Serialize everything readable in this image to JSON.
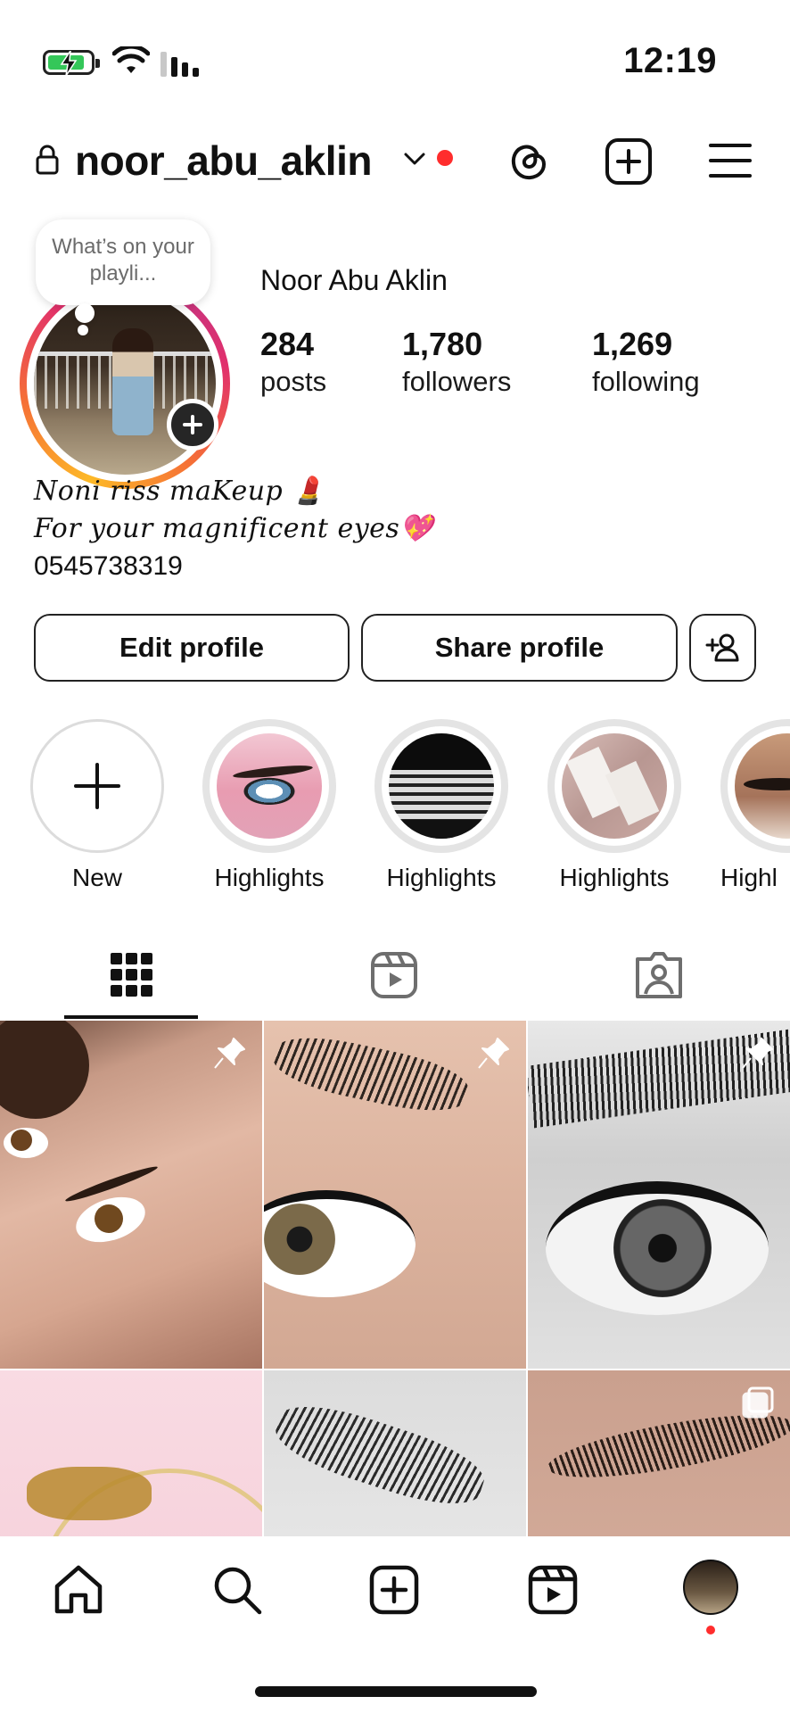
{
  "status_bar": {
    "time": "12:19"
  },
  "header": {
    "username": "noor_abu_aklin"
  },
  "profile": {
    "note": "What’s on your playli...",
    "display_name": "Noor Abu Aklin",
    "stats": [
      {
        "value": "284",
        "label": "posts"
      },
      {
        "value": "1,780",
        "label": "followers"
      },
      {
        "value": "1,269",
        "label": "following"
      }
    ],
    "bio": {
      "line1": "Noni riss maKeup 💄",
      "line2": "For your magnificent eyes💖",
      "phone": "0545738319"
    }
  },
  "buttons": {
    "edit": "Edit profile",
    "share": "Share profile"
  },
  "highlights": [
    {
      "label": "New"
    },
    {
      "label": "Highlights"
    },
    {
      "label": "Highlights"
    },
    {
      "label": "Highlights"
    },
    {
      "label": "Highl"
    }
  ],
  "icons": {
    "header": [
      "lock-icon",
      "chevron-down-icon",
      "threads-icon",
      "add-square-icon",
      "menu-icon"
    ],
    "tabs": [
      "grid-icon",
      "reels-icon",
      "tagged-icon"
    ],
    "nav": [
      "home-icon",
      "search-icon",
      "create-icon",
      "reels-icon",
      "profile-avatar"
    ]
  },
  "colors": {
    "accent_red": "#ff2d2d",
    "battery_green": "#34c759",
    "text": "#111111"
  }
}
